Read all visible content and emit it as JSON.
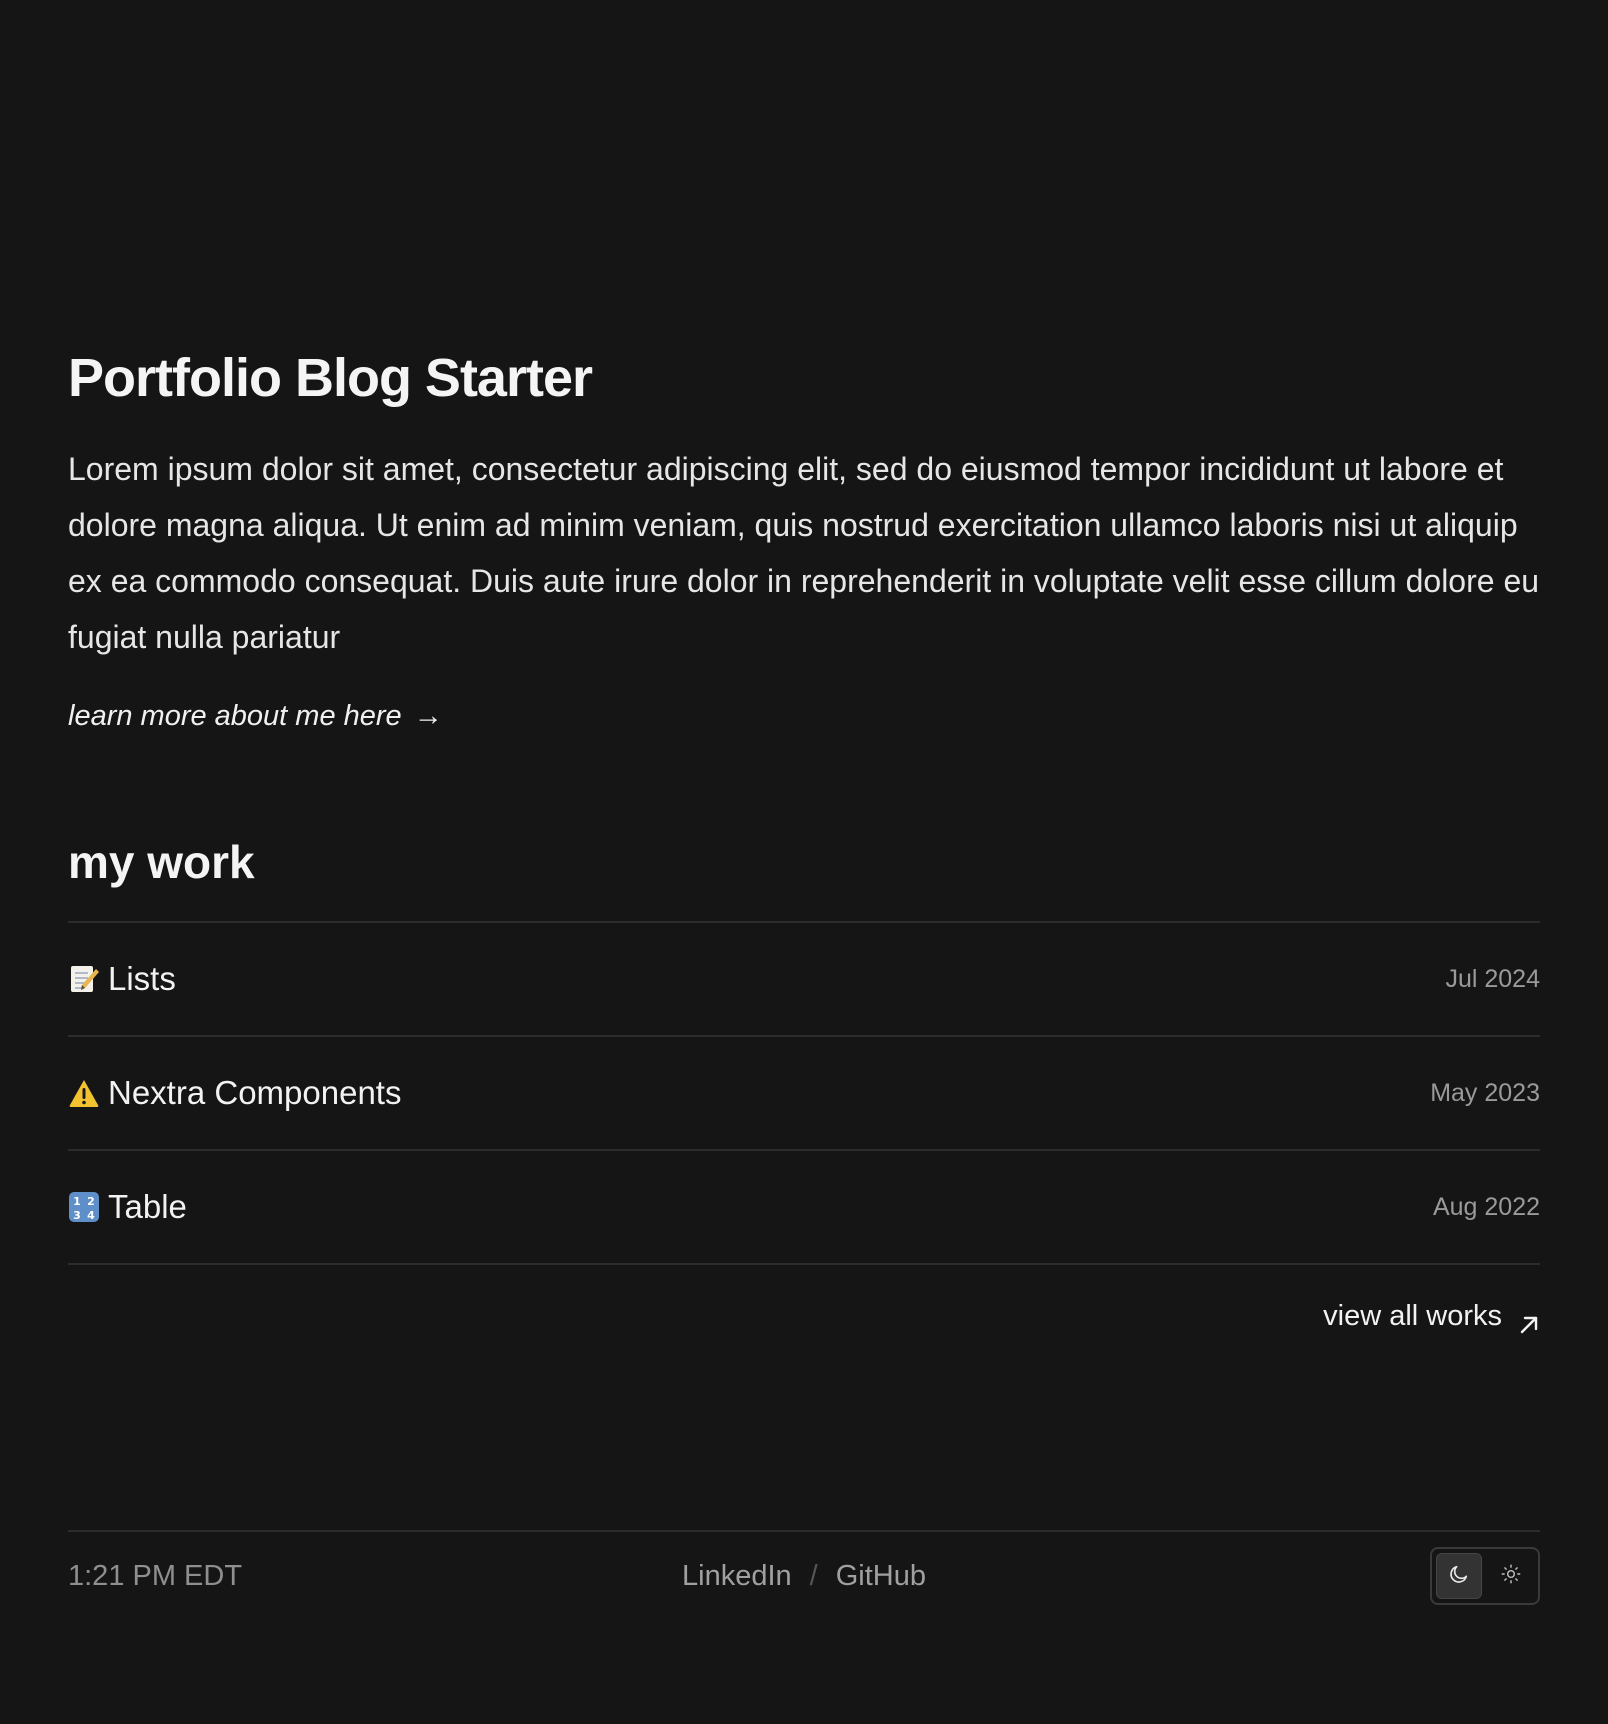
{
  "hero": {
    "title": "Portfolio Blog Starter",
    "intro": "Lorem ipsum dolor sit amet, consectetur adipiscing elit, sed do eiusmod tempor incididunt ut labore et dolore magna aliqua. Ut enim ad minim veniam, quis nostrud exercitation ullamco laboris nisi ut aliquip ex ea commodo consequat. Duis aute irure dolor in reprehenderit in voluptate velit esse cillum dolore eu fugiat nulla pariatur",
    "about_link": "learn more about me here",
    "about_arrow": "→"
  },
  "work": {
    "heading": "my work",
    "items": [
      {
        "icon": "memo-icon",
        "title": "Lists",
        "date": "Jul 2024"
      },
      {
        "icon": "warning-icon",
        "title": "Nextra Components",
        "date": "May 2023"
      },
      {
        "icon": "numbers-icon",
        "title": "Table",
        "date": "Aug 2022"
      }
    ],
    "view_all": "view all works"
  },
  "footer": {
    "time": "1:21 PM EDT",
    "links": [
      "LinkedIn",
      "GitHub"
    ],
    "separator": "/",
    "theme": {
      "active": "dark",
      "options": [
        "moon-icon",
        "sun-icon"
      ]
    }
  },
  "colors": {
    "background": "#151515",
    "text": "#ececec",
    "muted": "#9a9a9a",
    "divider": "#2c2c2c"
  }
}
